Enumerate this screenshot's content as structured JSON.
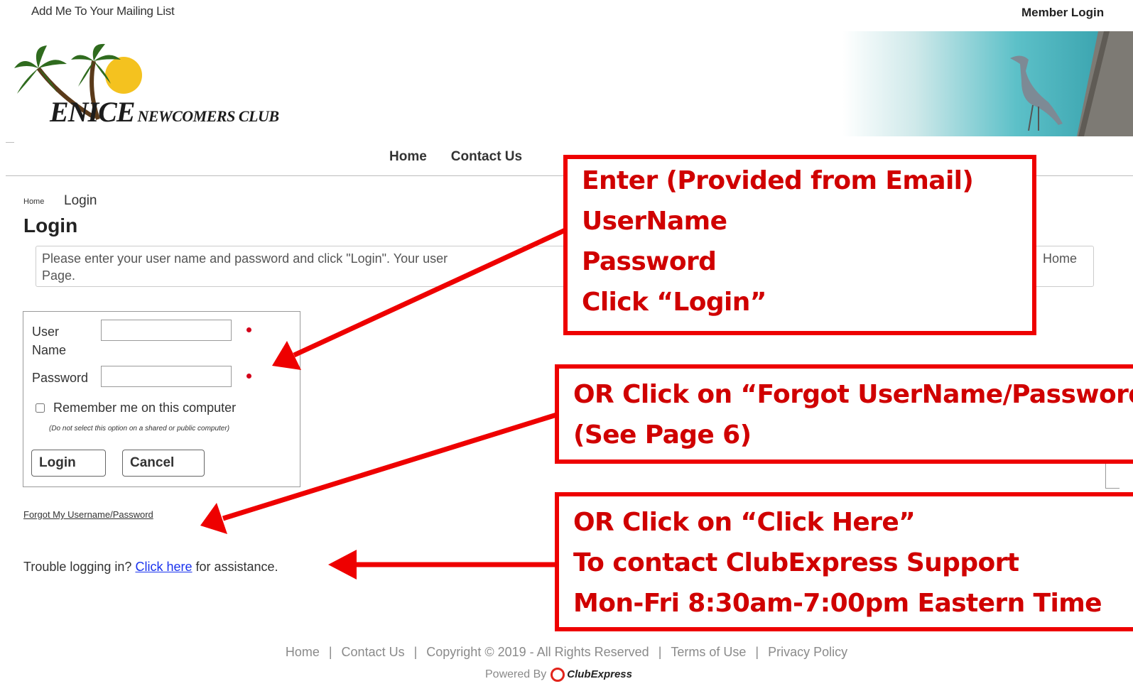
{
  "topbar": {
    "mailing_link": "Add Me To Your Mailing List",
    "member_login": "Member Login"
  },
  "logo": {
    "text_big": "ENICE",
    "text_small": "NEWCOMERS CLUB"
  },
  "nav": {
    "items": [
      "Home",
      "Contact Us"
    ]
  },
  "breadcrumb": {
    "home": "Home",
    "current": "Login"
  },
  "page": {
    "title": "Login",
    "instructions_line1": "Please enter your user name and password and click \"Login\". Your user",
    "instructions_tail": "Home",
    "instructions_line2": "Page."
  },
  "login_form": {
    "username_label_1": "User",
    "username_label_2": "Name",
    "password_label": "Password",
    "username_value": "",
    "password_value": "",
    "remember_label": "Remember me on this computer",
    "remember_checked": false,
    "shared_note": "(Do not select this option on a shared or public computer)",
    "login_button": "Login",
    "cancel_button": "Cancel"
  },
  "forgot_link": "Forgot My Username/Password",
  "trouble": {
    "prefix": "Trouble logging in?",
    "link": "Click here",
    "suffix": "for assistance."
  },
  "footer": {
    "links": [
      "Home",
      "Contact Us",
      "Copyright © 2019 - All Rights Reserved",
      "Terms of Use",
      "Privacy Policy"
    ],
    "separator": "|",
    "powered_by": "Powered By",
    "brand": "ClubExpress"
  },
  "annotations": {
    "callout1": [
      "Enter (Provided from Email)",
      "UserName",
      "Password",
      "Click “Login”"
    ],
    "callout2": [
      "OR Click on  “Forgot UserName/Password”",
      "(See Page 6)"
    ],
    "callout3": [
      "OR Click on “Click Here”",
      "To contact ClubExpress Support",
      "Mon-Fri 8:30am-7:00pm Eastern Time"
    ]
  },
  "colors": {
    "annotation_red": "#ee0000",
    "required_marker": "#d3001a",
    "link_blue": "#1a33ee"
  }
}
